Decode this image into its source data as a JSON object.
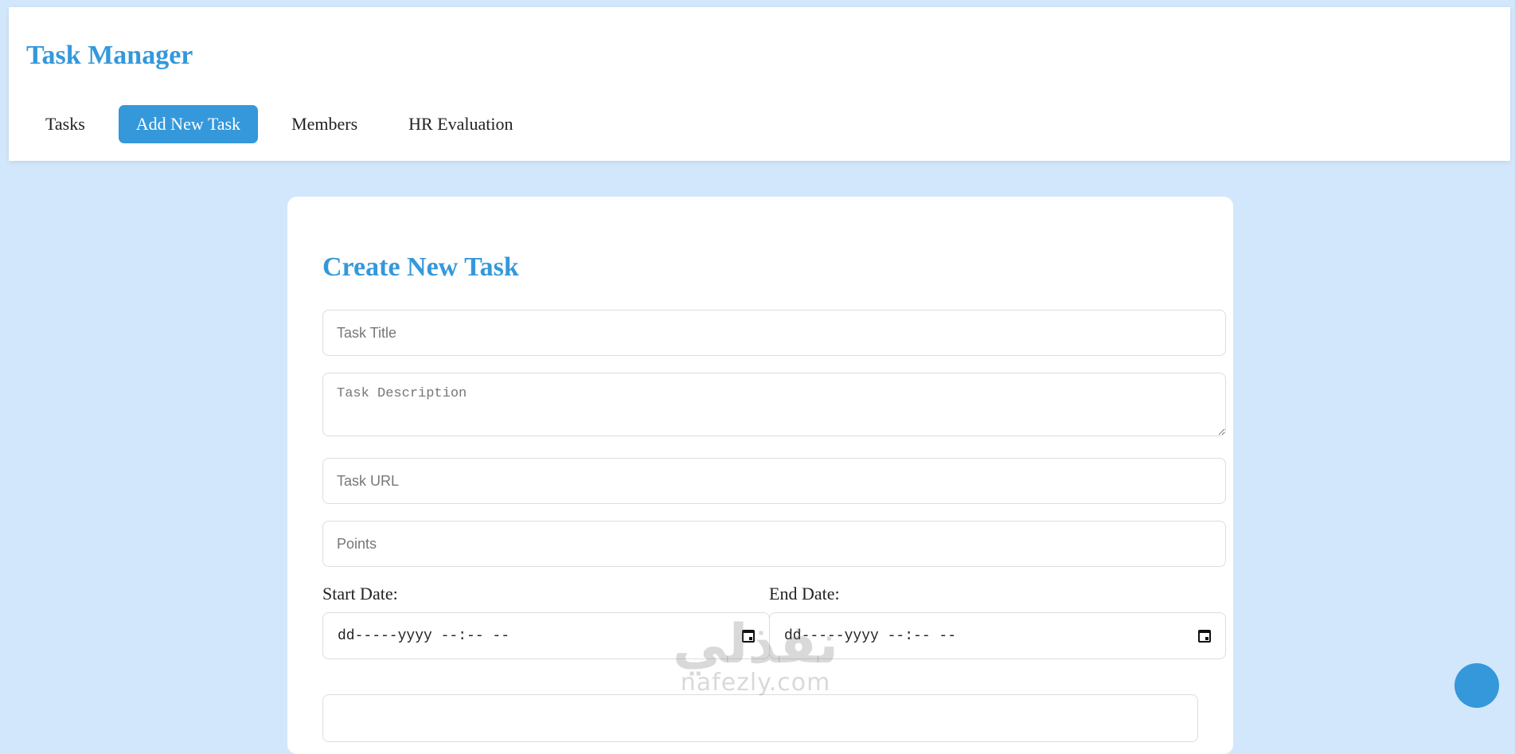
{
  "header": {
    "app_title": "Task Manager",
    "nav": [
      {
        "label": "Tasks",
        "active": false
      },
      {
        "label": "Add New Task",
        "active": true
      },
      {
        "label": "Members",
        "active": false
      },
      {
        "label": "HR Evaluation",
        "active": false
      }
    ]
  },
  "form": {
    "title": "Create New Task",
    "task_title": {
      "placeholder": "Task Title",
      "value": ""
    },
    "task_description": {
      "placeholder": "Task Description",
      "value": ""
    },
    "task_url": {
      "placeholder": "Task URL",
      "value": ""
    },
    "points": {
      "placeholder": "Points",
      "value": ""
    },
    "start_date": {
      "label": "Start Date:",
      "value": "dd-----yyyy --:-- --"
    },
    "end_date": {
      "label": "End Date:",
      "value": "dd-----yyyy --:-- --"
    }
  },
  "watermark": {
    "arabic": "نفذلي",
    "text": "nafezly.com"
  },
  "colors": {
    "accent": "#3498db",
    "page_bg": "#d2e7fb",
    "card_bg": "#ffffff"
  },
  "icons": {
    "date_picker": "calendar-icon",
    "fab": "circle-button"
  }
}
